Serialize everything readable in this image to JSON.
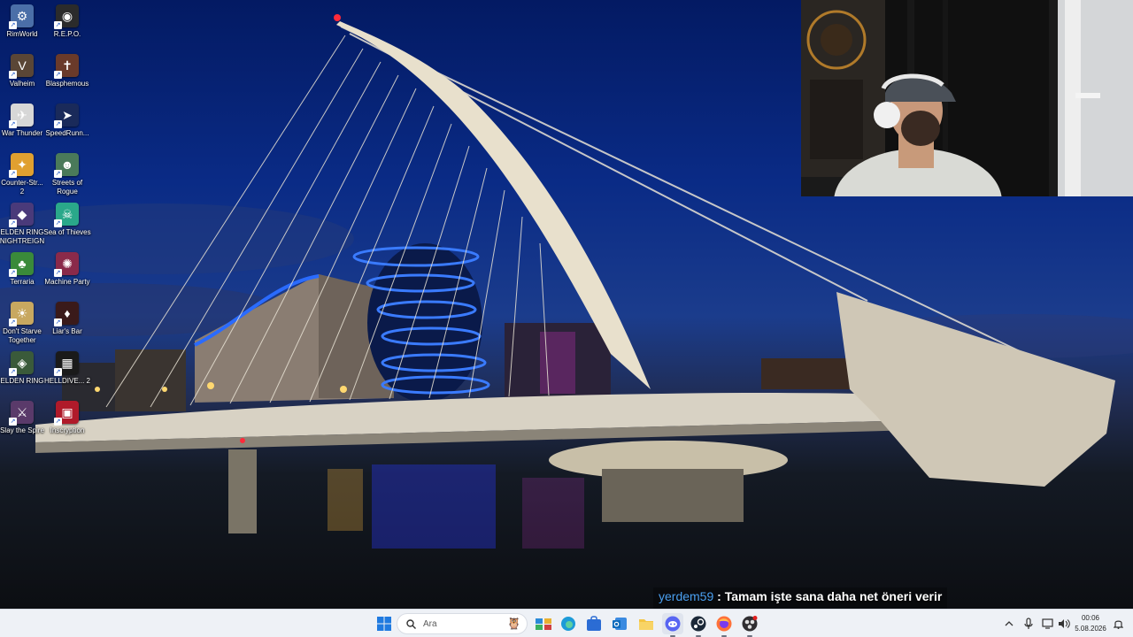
{
  "desktop": {
    "icons": [
      {
        "label": "RimWorld",
        "color": "#4b6fa8",
        "glyph": "⚙"
      },
      {
        "label": "R.E.P.O.",
        "color": "#2b2b2b",
        "glyph": "◉"
      },
      {
        "label": "Valheim",
        "color": "#5a4636",
        "glyph": "V"
      },
      {
        "label": "Blasphemous",
        "color": "#6a3a2a",
        "glyph": "✝"
      },
      {
        "label": "War Thunder",
        "color": "#d7d7d7",
        "glyph": "✈"
      },
      {
        "label": "SpeedRunn...",
        "color": "#1a2a5a",
        "glyph": "➤"
      },
      {
        "label": "Counter-Str... 2",
        "color": "#e0a030",
        "glyph": "✦"
      },
      {
        "label": "Streets of Rogue",
        "color": "#4a7a5a",
        "glyph": "☻"
      },
      {
        "label": "ELDEN RING NIGHTREIGN",
        "color": "#4a3a7a",
        "glyph": "◆"
      },
      {
        "label": "Sea of Thieves",
        "color": "#2aa88a",
        "glyph": "☠"
      },
      {
        "label": "Terraria",
        "color": "#3a8a3a",
        "glyph": "♣"
      },
      {
        "label": "Machine Party",
        "color": "#8a2a4a",
        "glyph": "✺"
      },
      {
        "label": "Don't Starve Together",
        "color": "#c8a860",
        "glyph": "☀"
      },
      {
        "label": "Liar's Bar",
        "color": "#3a1a1a",
        "glyph": "♦"
      },
      {
        "label": "ELDEN RING",
        "color": "#3a5a3a",
        "glyph": "◈"
      },
      {
        "label": "HELLDIVE... 2",
        "color": "#1a1a1a",
        "glyph": "▦"
      },
      {
        "label": "Slay the Spire",
        "color": "#5a3a6a",
        "glyph": "⚔"
      },
      {
        "label": "Inscryption",
        "color": "#b01a2a",
        "glyph": "▣"
      }
    ]
  },
  "chat": {
    "username": "yerdem59",
    "separator": " : ",
    "message": "Tamam işte sana daha net öneri verir"
  },
  "taskbar": {
    "search_placeholder": "Ara",
    "apps": [
      {
        "name": "windows-start",
        "color": "#1f7ae0"
      },
      {
        "name": "file-explorer",
        "color": "#f2b632"
      },
      {
        "name": "edge",
        "color": "#1d9bd8"
      },
      {
        "name": "store",
        "color": "#2b6cd4"
      },
      {
        "name": "outlook",
        "color": "#0f6cbd"
      },
      {
        "name": "folder",
        "color": "#f4c542"
      },
      {
        "name": "discord",
        "color": "#5865f2"
      },
      {
        "name": "steam",
        "color": "#1b2838"
      },
      {
        "name": "firefox",
        "color": "#ff7139"
      },
      {
        "name": "obs",
        "color": "#302e31"
      }
    ],
    "clock": {
      "time": "00:06",
      "date": "5.08.2026"
    }
  }
}
